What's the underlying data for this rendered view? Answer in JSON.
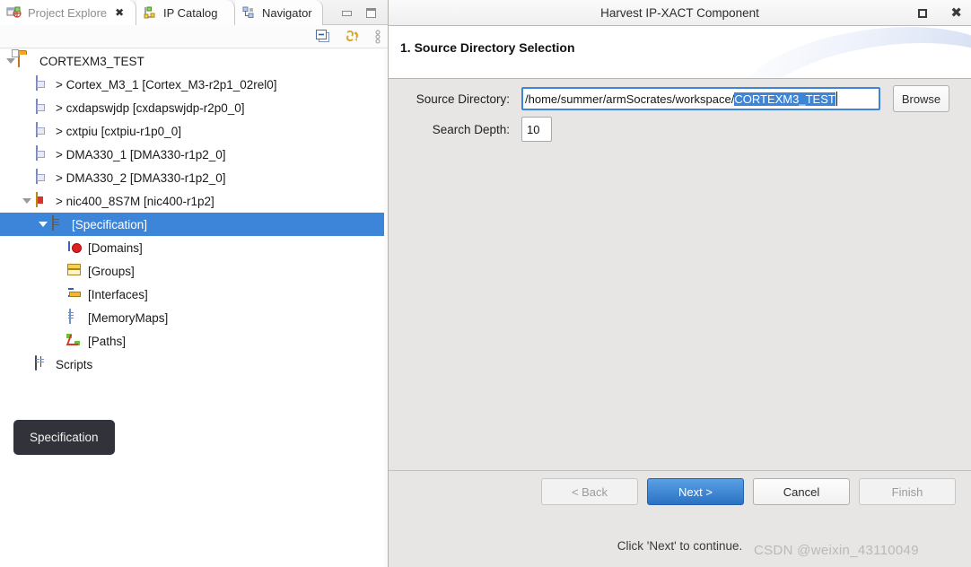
{
  "ide": {
    "tabs": [
      {
        "label": "Project Explore",
        "icon": "project-explorer-icon",
        "active": true,
        "closeable": true
      },
      {
        "label": "IP Catalog",
        "icon": "ip-catalog-icon",
        "active": false,
        "closeable": false
      },
      {
        "label": "Navigator",
        "icon": "navigator-icon",
        "active": false,
        "closeable": false
      }
    ],
    "window_buttons": [
      {
        "name": "minimize-view-button",
        "glyph": "minimize"
      },
      {
        "name": "maximize-view-button",
        "glyph": "maximize"
      }
    ],
    "view_toolbar": [
      {
        "name": "collapse-all-icon",
        "title": "Collapse All"
      },
      {
        "name": "link-with-editor-icon",
        "title": "Link with Editor"
      },
      {
        "name": "view-menu-icon",
        "title": "View Menu"
      }
    ],
    "tree": [
      {
        "label": "CORTEXM3_TEST",
        "indent": 0,
        "icon": "project-folder-icon",
        "twisty": "open",
        "selected": false
      },
      {
        "label": "> Cortex_M3_1 [Cortex_M3-r2p1_02rel0]",
        "indent": 1,
        "icon": "component-icon",
        "twisty": "none",
        "selected": false
      },
      {
        "label": "> cxdapswjdp [cxdapswjdp-r2p0_0]",
        "indent": 1,
        "icon": "component-icon",
        "twisty": "none",
        "selected": false
      },
      {
        "label": "> cxtpiu [cxtpiu-r1p0_0]",
        "indent": 1,
        "icon": "component-icon",
        "twisty": "none",
        "selected": false
      },
      {
        "label": "> DMA330_1 [DMA330-r1p2_0]",
        "indent": 1,
        "icon": "component-icon",
        "twisty": "none",
        "selected": false
      },
      {
        "label": "> DMA330_2 [DMA330-r1p2_0]",
        "indent": 1,
        "icon": "component-icon",
        "twisty": "none",
        "selected": false
      },
      {
        "label": "> nic400_8S7M [nic400-r1p2]",
        "indent": 1,
        "icon": "nic-icon",
        "twisty": "open",
        "selected": false
      },
      {
        "label": "[Specification]",
        "indent": 2,
        "icon": "specification-icon",
        "twisty": "open",
        "selected": true
      },
      {
        "label": "[Domains]",
        "indent": 3,
        "icon": "domains-icon",
        "twisty": "none",
        "selected": false
      },
      {
        "label": "[Groups]",
        "indent": 3,
        "icon": "groups-icon",
        "twisty": "none",
        "selected": false
      },
      {
        "label": "[Interfaces]",
        "indent": 3,
        "icon": "interfaces-icon",
        "twisty": "none",
        "selected": false
      },
      {
        "label": "[MemoryMaps]",
        "indent": 3,
        "icon": "memory-maps-icon",
        "twisty": "none",
        "selected": false
      },
      {
        "label": "[Paths]",
        "indent": 3,
        "icon": "paths-icon",
        "twisty": "none",
        "selected": false
      },
      {
        "label": "Scripts",
        "indent": 2,
        "icon": "scripts-icon",
        "twisty": "none",
        "selected": false
      }
    ],
    "tooltip": {
      "text": "Specification"
    }
  },
  "dialog": {
    "title": "Harvest IP-XACT Component",
    "titlebar_buttons": [
      {
        "name": "maximize-dialog-button",
        "glyph": "maximize"
      },
      {
        "name": "close-dialog-button",
        "glyph": "close"
      }
    ],
    "step_title": "1. Source Directory Selection",
    "fields": {
      "source_directory": {
        "label": "Source Directory:",
        "value_prefix": "/home/summer/armSocrates/workspace/",
        "value_selected": "CORTEXM3_TEST",
        "full_value": "/home/summer/armSocrates/workspace/CORTEXM3_TEST",
        "browse_label": "Browse"
      },
      "search_depth": {
        "label": "Search Depth:",
        "value": "10"
      }
    },
    "hint": "Click 'Next' to continue.",
    "buttons": [
      {
        "name": "back-button",
        "label": "< Back",
        "state": "disabled"
      },
      {
        "name": "next-button",
        "label": "Next >",
        "state": "primary"
      },
      {
        "name": "cancel-button",
        "label": "Cancel",
        "state": "normal"
      },
      {
        "name": "finish-button",
        "label": "Finish",
        "state": "disabled"
      }
    ]
  },
  "watermark": {
    "text": "CSDN @weixin_43110049"
  },
  "colors": {
    "selection_blue": "#3d85d8",
    "primary_button": "#2b72c4",
    "dialog_bg": "#e8e6e4",
    "tooltip_bg": "#32323a"
  }
}
